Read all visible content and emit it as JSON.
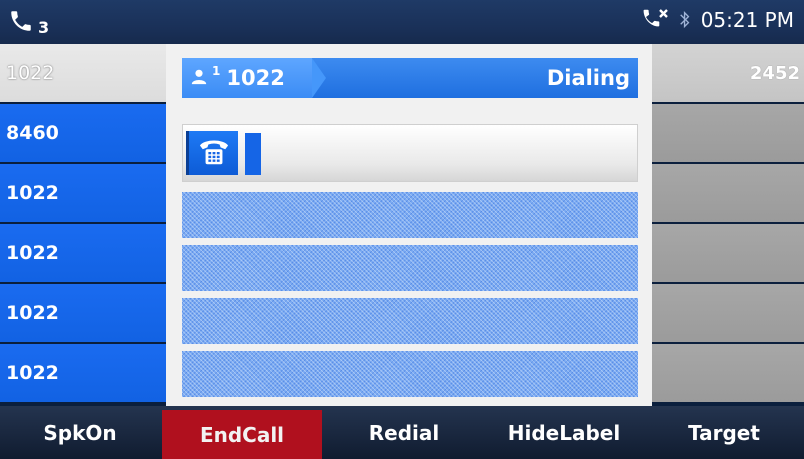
{
  "status_bar": {
    "line_count": "3",
    "time": "05:21 PM",
    "icons": [
      "phone-icon",
      "missed-call-icon",
      "bluetooth-icon"
    ]
  },
  "left_keys": [
    "1022",
    "8460",
    "1022",
    "1022",
    "1022",
    "1022"
  ],
  "call": {
    "account_index": "1",
    "number": "1022",
    "status": "Dialing"
  },
  "right_keys": [
    "2452",
    "",
    "",
    "",
    "",
    ""
  ],
  "softkeys": [
    "SpkOn",
    "EndCall",
    "Redial",
    "HideLabel",
    "Target"
  ],
  "colors": {
    "accent_blue": "#1565e6",
    "endcall_red": "#b0101e",
    "statusbar": "#1a3159"
  }
}
